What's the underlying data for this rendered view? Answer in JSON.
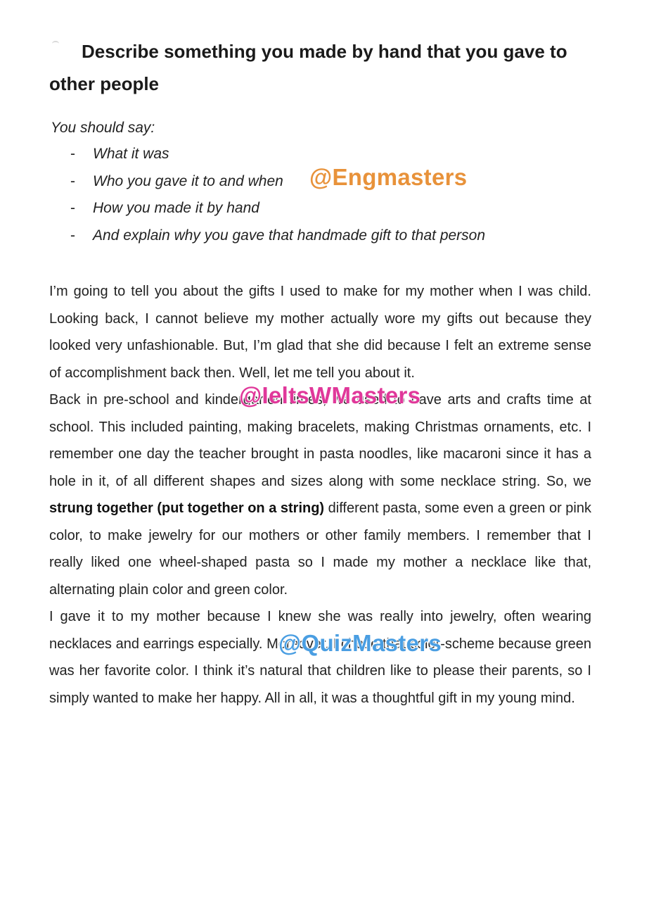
{
  "document": {
    "title": "Describe something you made by hand that you gave to other people",
    "should_say": "You should say:",
    "cues": [
      "What it was",
      "Who you gave it to and when",
      "How you made it by hand",
      "And explain why you gave that handmade gift to that person"
    ],
    "cue_bullet": "-",
    "para1": "I’m going to tell you about the gifts I used to make for my mother when I was child. Looking back, I cannot believe my mother actually wore my gifts out because they looked very unfashionable. But, I’m glad that she did because I felt an extreme sense of accomplishment back then. Well, let me tell you about it.",
    "para2_before": "Back in pre-school and kindergarten times, we used to have arts and crafts time at school. This included painting, making bracelets, making Christmas ornaments, etc. I remember one day the teacher brought in pasta noodles, like macaroni since it has a hole in it,  of all different shapes and sizes along with some necklace string. So, we ",
    "para2_bold": "strung together (put together on a string)",
    "para2_after": " different pasta, some even a green or pink color, to make jewelry for our mothers or other family members. I remember that I really liked one wheel-shaped pasta so I made my mother a necklace like that, alternating plain color and green color.",
    "para3": "I gave it to my mother because I knew she was really into jewelry, often wearing necklaces and earrings especially. Moreover, I chose that color-scheme because green was her favorite color. I think it’s natural that children like to please their parents, so I simply wanted to make her happy. All in all, it was a thoughtful gift in my young mind."
  },
  "watermarks": [
    {
      "text": "@Engmasters",
      "color": "#e8923a"
    },
    {
      "text": "@IeltsWMasters",
      "color": "#e0389a"
    },
    {
      "text": "@QuizMasters",
      "color": "#4a9ee2"
    }
  ]
}
